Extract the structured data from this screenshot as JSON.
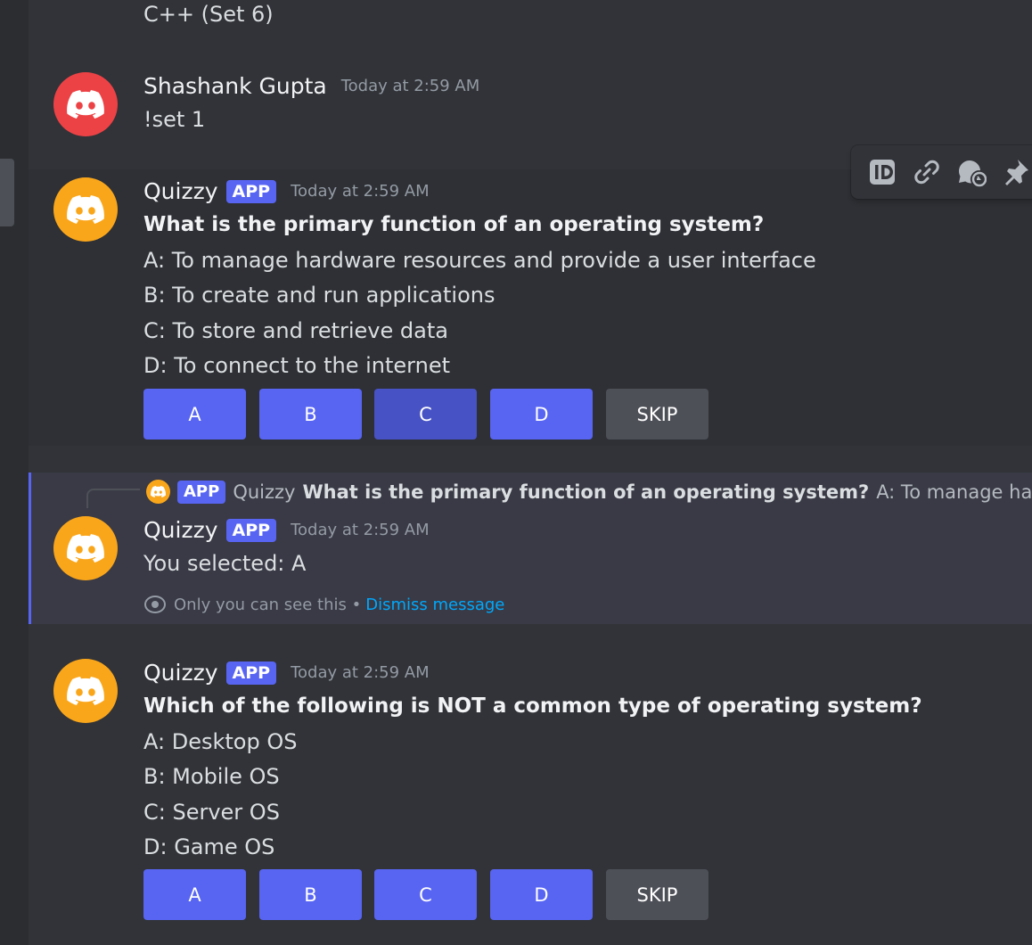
{
  "top_fragment": "C++ (Set 6)",
  "messages": [
    {
      "author": "Shashank Gupta",
      "timestamp": "Today at 2:59 AM",
      "text": "!set 1"
    },
    {
      "author": "Quizzy",
      "badge": "APP",
      "timestamp": "Today at 2:59 AM",
      "question": "What is the primary function of an operating system?",
      "options": [
        "A: To manage hardware resources and provide a user interface",
        "B: To create and run applications",
        "C: To store and retrieve data",
        "D: To connect to the internet"
      ],
      "buttons": [
        "A",
        "B",
        "C",
        "D",
        "SKIP"
      ]
    },
    {
      "reply": {
        "badge": "APP",
        "name": "Quizzy",
        "question": "What is the primary function of an operating system?",
        "preview": "A: To manage hardwa"
      },
      "author": "Quizzy",
      "badge": "APP",
      "timestamp": "Today at 2:59 AM",
      "text": "You selected: A",
      "note": "Only you can see this •",
      "dismiss": "Dismiss message"
    },
    {
      "author": "Quizzy",
      "badge": "APP",
      "timestamp": "Today at 2:59 AM",
      "question": "Which of the following is NOT a common type of operating system?",
      "options": [
        "A: Desktop OS",
        "B: Mobile OS",
        "C: Server OS",
        "D: Game OS"
      ],
      "buttons": [
        "A",
        "B",
        "C",
        "D",
        "SKIP"
      ]
    }
  ],
  "toolbar": [
    "id-icon",
    "link-icon",
    "reply-thread-icon",
    "pin-icon"
  ],
  "colors": {
    "background": "#313338",
    "blurple": "#5865f2",
    "avatar_red": "#ed4245",
    "avatar_orange": "#faa61a",
    "link": "#00a8fc"
  }
}
